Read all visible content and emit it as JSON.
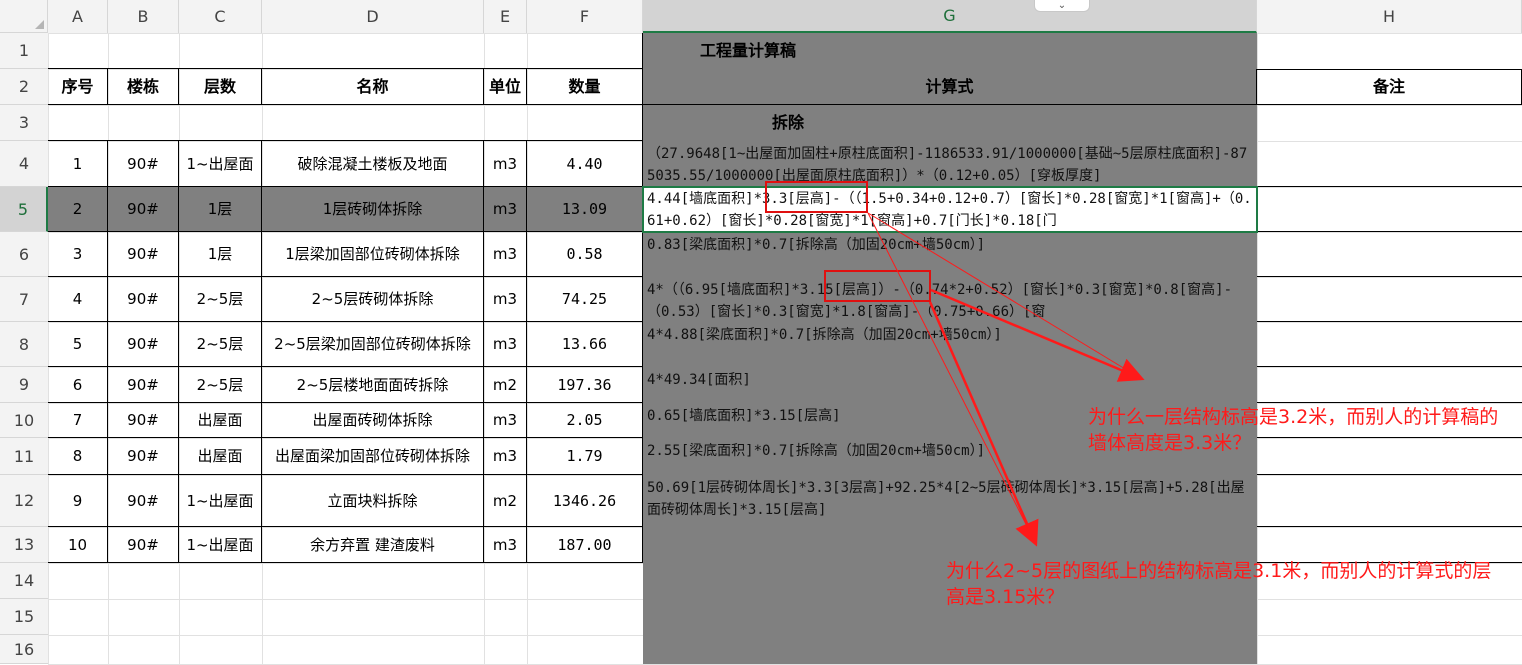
{
  "columns": [
    "A",
    "B",
    "C",
    "D",
    "E",
    "F",
    "G",
    "H"
  ],
  "selected_column": "G",
  "rows": [
    "1",
    "2",
    "3",
    "4",
    "5",
    "6",
    "7",
    "8",
    "9",
    "10",
    "11",
    "12",
    "13",
    "14",
    "15",
    "16"
  ],
  "selected_row": "5",
  "title": "工程量计算稿",
  "headers": {
    "seq": "序号",
    "building": "楼栋",
    "floor": "层数",
    "name": "名称",
    "unit": "单位",
    "qty": "数量",
    "formula": "计算式",
    "remark": "备注"
  },
  "section": "拆除",
  "data_rows": [
    {
      "seq": "1",
      "building": "90#",
      "floor": "1~出屋面",
      "name": "破除混凝土楼板及地面",
      "unit": "m3",
      "qty": "4.40",
      "formula": "（27.9648[1~出屋面加固柱+原柱底面积]-1186533.91/1000000[基础~5层原柱底面积]-875035.55/1000000[出屋面原柱底面积]）*（0.12+0.05）[穿板厚度]"
    },
    {
      "seq": "2",
      "building": "90#",
      "floor": "1层",
      "name": "1层砖砌体拆除",
      "unit": "m3",
      "qty": "13.09",
      "formula": "4.44[墙底面积]*3.3[层高]-（（1.5+0.34+0.12+0.7）[窗长]*0.28[窗宽]*1[窗高]+（0.61+0.62）[窗长]*0.28[窗宽]*1[窗高]+0.7[门长]*0.18[门"
    },
    {
      "seq": "3",
      "building": "90#",
      "floor": "1层",
      "name": "1层梁加固部位砖砌体拆除",
      "unit": "m3",
      "qty": "0.58",
      "formula": "0.83[梁底面积]*0.7[拆除高（加固20cm+墙50cm）]"
    },
    {
      "seq": "4",
      "building": "90#",
      "floor": "2~5层",
      "name": "2~5层砖砌体拆除",
      "unit": "m3",
      "qty": "74.25",
      "formula": "4*（（6.95[墙底面积]*3.15[层高]）-（0.74*2+0.52）[窗长]*0.3[窗宽]*0.8[窗高]-（0.53）[窗长]*0.3[窗宽]*1.8[窗高]-（0.75+0.66）[窗"
    },
    {
      "seq": "5",
      "building": "90#",
      "floor": "2~5层",
      "name": "2~5层梁加固部位砖砌体拆除",
      "unit": "m3",
      "qty": "13.66",
      "formula": "4*4.88[梁底面积]*0.7[拆除高（加固20cm+墙50cm）]"
    },
    {
      "seq": "6",
      "building": "90#",
      "floor": "2~5层",
      "name": "2~5层楼地面面砖拆除",
      "unit": "m2",
      "qty": "197.36",
      "formula": "4*49.34[面积]"
    },
    {
      "seq": "7",
      "building": "90#",
      "floor": "出屋面",
      "name": "出屋面砖砌体拆除",
      "unit": "m3",
      "qty": "2.05",
      "formula": "0.65[墙底面积]*3.15[层高]"
    },
    {
      "seq": "8",
      "building": "90#",
      "floor": "出屋面",
      "name": "出屋面梁加固部位砖砌体拆除",
      "unit": "m3",
      "qty": "1.79",
      "formula": "2.55[梁底面积]*0.7[拆除高（加固20cm+墙50cm）]"
    },
    {
      "seq": "9",
      "building": "90#",
      "floor": "1~出屋面",
      "name": "立面块料拆除",
      "unit": "m2",
      "qty": "1346.26",
      "formula": "50.69[1层砖砌体周长]*3.3[3层高]+92.25*4[2~5层砖砌体周长]*3.15[层高]+5.28[出屋面砖砌体周长]*3.15[层高]"
    },
    {
      "seq": "10",
      "building": "90#",
      "floor": "1~出屋面",
      "name": "余方弃置 建渣废料",
      "unit": "m3",
      "qty": "187.00",
      "formula": ""
    }
  ],
  "annotations": [
    "为什么一层结构标高是3.2米，而别人的计算稿的墙体高度是3.3米？",
    "为什么2~5层的图纸上的结构标高是3.1米，而别人的计算式的层高是3.15米？"
  ],
  "colors": {
    "shade": "#808080",
    "selection": "#1e7b45",
    "annotation": "#ff1a1a"
  }
}
